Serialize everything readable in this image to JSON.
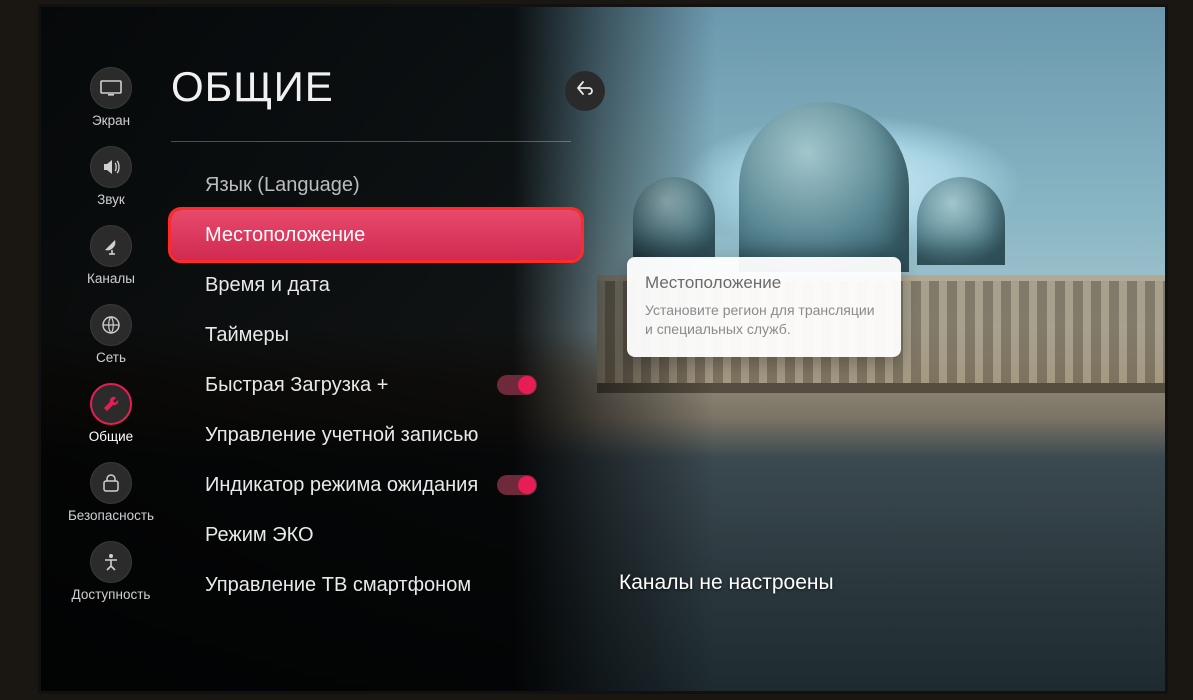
{
  "header": {
    "title": "ОБЩИЕ"
  },
  "sidebar": {
    "items": [
      {
        "key": "screen",
        "label": "Экран"
      },
      {
        "key": "sound",
        "label": "Звук"
      },
      {
        "key": "channels",
        "label": "Каналы"
      },
      {
        "key": "network",
        "label": "Сеть"
      },
      {
        "key": "general",
        "label": "Общие"
      },
      {
        "key": "security",
        "label": "Безопасность"
      },
      {
        "key": "accessibility",
        "label": "Доступность"
      }
    ]
  },
  "menu": {
    "items": [
      {
        "label": "Язык (Language)"
      },
      {
        "label": "Местоположение"
      },
      {
        "label": "Время и дата"
      },
      {
        "label": "Таймеры"
      },
      {
        "label": "Быстрая Загрузка +",
        "toggle": true,
        "on": true
      },
      {
        "label": "Управление учетной записью"
      },
      {
        "label": "Индикатор режима ожидания",
        "toggle": true,
        "on": true
      },
      {
        "label": "Режим ЭКО"
      },
      {
        "label": "Управление ТВ смартфоном"
      }
    ]
  },
  "info": {
    "title": "Местоположение",
    "body": "Установите регион для трансляции и специальных служб."
  },
  "status": {
    "text": "Каналы не настроены"
  }
}
